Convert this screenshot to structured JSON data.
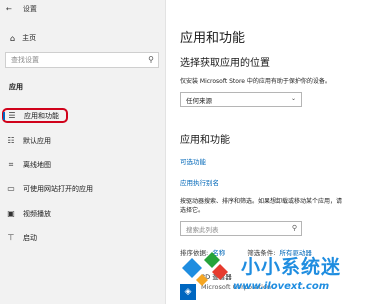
{
  "window": {
    "title": "设置",
    "back_glyph": "←"
  },
  "sidebar": {
    "home_label": "主页",
    "search_placeholder": "查找设置",
    "section_title": "应用",
    "items": [
      {
        "label": "应用和功能",
        "icon": "apps-list-icon",
        "glyph": "☰",
        "active": true
      },
      {
        "label": "默认应用",
        "icon": "default-apps-icon",
        "glyph": "☷",
        "active": false
      },
      {
        "label": "离线地图",
        "icon": "map-icon",
        "glyph": "⌗",
        "active": false
      },
      {
        "label": "可使用网站打开的应用",
        "icon": "web-apps-icon",
        "glyph": "▭",
        "active": false
      },
      {
        "label": "视频播放",
        "icon": "video-icon",
        "glyph": "▣",
        "active": false
      },
      {
        "label": "启动",
        "icon": "startup-icon",
        "glyph": "⊤",
        "active": false
      }
    ]
  },
  "main": {
    "title": "应用和功能",
    "source_heading": "选择获取应用的位置",
    "source_desc": "仅安装 Microsoft Store 中的应用有助于保护你的设备。",
    "source_value": "任何来源",
    "apps_heading": "应用和功能",
    "link_optional": "可选功能",
    "link_aliases": "应用执行别名",
    "desc_line1": "按驱动器搜索、排序和筛选。如果想卸载或移动某个应用，请",
    "desc_line2": "选择它。",
    "search_placeholder": "搜索此列表",
    "sort_label": "排序依据:",
    "sort_value": "名称",
    "filter_label": "筛选条件:",
    "filter_value": "所有驱动器",
    "app": {
      "name": "3D 查看器",
      "publisher": "Microsoft Corporation"
    }
  },
  "watermark": {
    "brand": "小小系统迷",
    "url": "www.ilovext.com"
  },
  "colors": {
    "accent": "#0067b8",
    "highlight_border": "#d0021b",
    "watermark": "#1f8de0"
  }
}
